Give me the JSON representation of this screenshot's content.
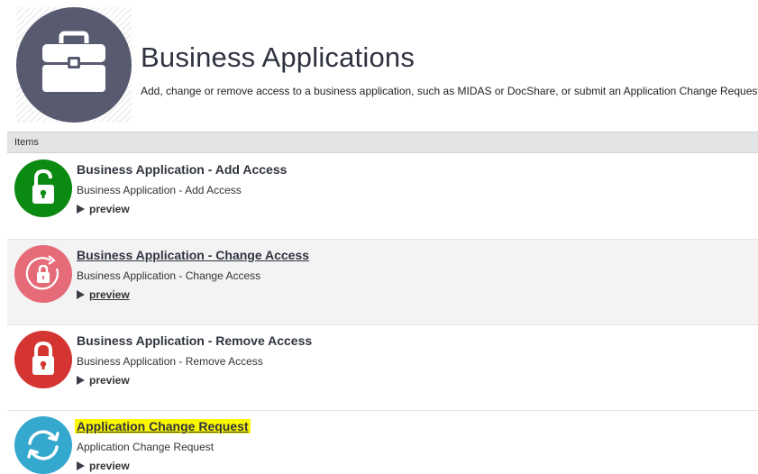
{
  "header": {
    "icon": "briefcase-icon",
    "icon_bg": "#585b70",
    "title": "Business Applications",
    "subtitle": "Add, change or remove access to a business application, such as MIDAS or DocShare, or submit an Application Change Request"
  },
  "items_header": "Items",
  "items": [
    {
      "title": "Business Application - Add Access",
      "description": "Business Application - Add Access",
      "preview": "preview",
      "icon": "lock-open-icon",
      "color": "#0b8a12"
    },
    {
      "title": "Business Application - Change Access",
      "description": "Business Application - Change Access",
      "preview": "preview",
      "icon": "lock-refresh-icon",
      "color": "#e56b78"
    },
    {
      "title": "Business Application - Remove Access",
      "description": "Business Application - Remove Access",
      "preview": "preview",
      "icon": "lock-closed-icon",
      "color": "#d43532"
    },
    {
      "title": "Application Change Request",
      "description": "Application Change Request",
      "preview": "preview",
      "icon": "sync-icon",
      "color": "#35a8cf"
    }
  ]
}
